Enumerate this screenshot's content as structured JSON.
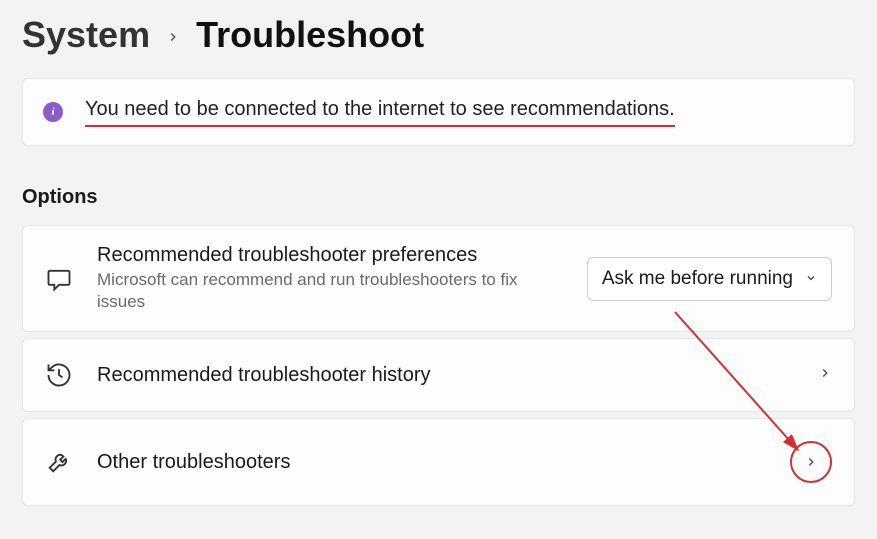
{
  "breadcrumb": {
    "parent": "System",
    "current": "Troubleshoot"
  },
  "banner": {
    "text": "You need to be connected to the internet to see recommendations."
  },
  "section_label": "Options",
  "cards": {
    "prefs": {
      "title": "Recommended troubleshooter preferences",
      "subtitle": "Microsoft can recommend and run troubleshooters to fix issues",
      "dropdown_value": "Ask me before running"
    },
    "history": {
      "title": "Recommended troubleshooter history"
    },
    "other": {
      "title": "Other troubleshooters"
    }
  }
}
